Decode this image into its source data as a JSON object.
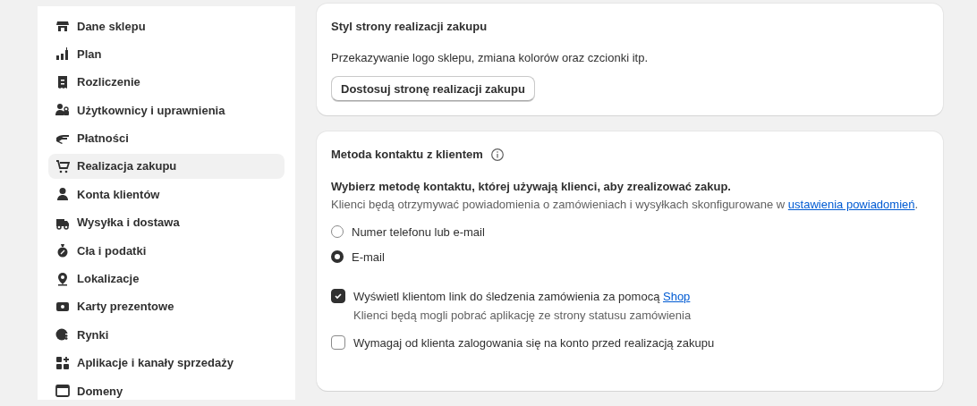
{
  "sidebar": {
    "items": [
      {
        "label": "Dane sklepu",
        "selected": false
      },
      {
        "label": "Plan",
        "selected": false
      },
      {
        "label": "Rozliczenie",
        "selected": false
      },
      {
        "label": "Użytkownicy i uprawnienia",
        "selected": false
      },
      {
        "label": "Płatności",
        "selected": false
      },
      {
        "label": "Realizacja zakupu",
        "selected": true
      },
      {
        "label": "Konta klientów",
        "selected": false
      },
      {
        "label": "Wysyłka i dostawa",
        "selected": false
      },
      {
        "label": "Cła i podatki",
        "selected": false
      },
      {
        "label": "Lokalizacje",
        "selected": false
      },
      {
        "label": "Karty prezentowe",
        "selected": false
      },
      {
        "label": "Rynki",
        "selected": false
      },
      {
        "label": "Aplikacje i kanały sprzedaży",
        "selected": false
      },
      {
        "label": "Domeny",
        "selected": false
      }
    ]
  },
  "checkout_style": {
    "title": "Styl strony realizacji zakupu",
    "description": "Przekazywanie logo sklepu, zmiana kolorów oraz czcionki itp.",
    "button": "Dostosuj stronę realizacji zakupu"
  },
  "contact_method": {
    "title": "Metoda kontaktu z klientem",
    "question": "Wybierz metodę kontaktu, której używają klienci, aby zrealizować zakup.",
    "help": "Klienci będą otrzymywać powiadomienia o zamówieniach i wysyłkach skonfigurowane w ",
    "help_link": "ustawienia powiadomień",
    "help_end": ".",
    "options": [
      {
        "label": "Numer telefonu lub e-mail",
        "selected": false
      },
      {
        "label": "E-mail",
        "selected": true
      }
    ],
    "checkboxes": [
      {
        "label": "Wyświetl klientom link do śledzenia zamówienia za pomocą ",
        "link": "Shop",
        "hint": "Klienci będą mogli pobrać aplikację ze strony statusu zamówienia",
        "checked": true
      },
      {
        "label": "Wymagaj od klienta zalogowania się na konto przed realizacją zakupu",
        "checked": false
      }
    ]
  }
}
